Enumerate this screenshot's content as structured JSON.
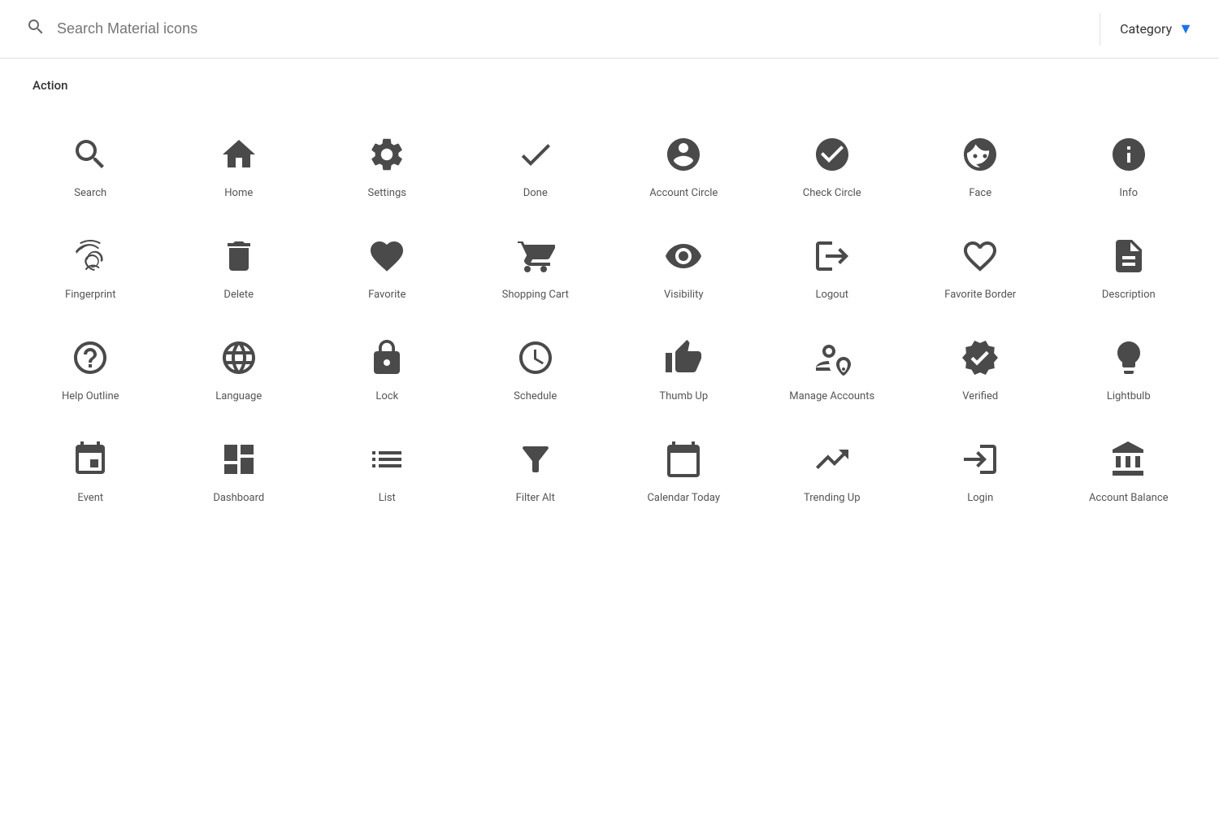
{
  "header": {
    "search_placeholder": "Search Material icons",
    "category_label": "Category"
  },
  "section": {
    "title": "Action"
  },
  "icons": [
    {
      "name": "Search",
      "id": "search"
    },
    {
      "name": "Home",
      "id": "home"
    },
    {
      "name": "Settings",
      "id": "settings"
    },
    {
      "name": "Done",
      "id": "done"
    },
    {
      "name": "Account Circle",
      "id": "account-circle"
    },
    {
      "name": "Check Circle",
      "id": "check-circle"
    },
    {
      "name": "Face",
      "id": "face"
    },
    {
      "name": "Info",
      "id": "info"
    },
    {
      "name": "Fingerprint",
      "id": "fingerprint"
    },
    {
      "name": "Delete",
      "id": "delete"
    },
    {
      "name": "Favorite",
      "id": "favorite"
    },
    {
      "name": "Shopping Cart",
      "id": "shopping-cart"
    },
    {
      "name": "Visibility",
      "id": "visibility"
    },
    {
      "name": "Logout",
      "id": "logout"
    },
    {
      "name": "Favorite Border",
      "id": "favorite-border"
    },
    {
      "name": "Description",
      "id": "description"
    },
    {
      "name": "Help Outline",
      "id": "help-outline"
    },
    {
      "name": "Language",
      "id": "language"
    },
    {
      "name": "Lock",
      "id": "lock"
    },
    {
      "name": "Schedule",
      "id": "schedule"
    },
    {
      "name": "Thumb Up",
      "id": "thumb-up"
    },
    {
      "name": "Manage Accounts",
      "id": "manage-accounts"
    },
    {
      "name": "Verified",
      "id": "verified"
    },
    {
      "name": "Lightbulb",
      "id": "lightbulb"
    },
    {
      "name": "Event",
      "id": "event"
    },
    {
      "name": "Dashboard",
      "id": "dashboard"
    },
    {
      "name": "List",
      "id": "list"
    },
    {
      "name": "Filter Alt",
      "id": "filter-alt"
    },
    {
      "name": "Calendar Today",
      "id": "calendar-today"
    },
    {
      "name": "Trending Up",
      "id": "trending-up"
    },
    {
      "name": "Login",
      "id": "login"
    },
    {
      "name": "Account Balance",
      "id": "account-balance"
    }
  ]
}
